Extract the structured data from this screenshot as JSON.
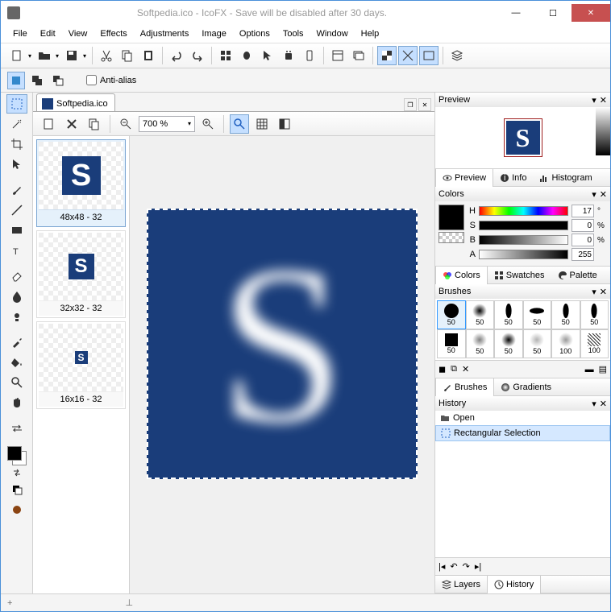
{
  "title": "Softpedia.ico - IcoFX - Save will be disabled after 30 days.",
  "menu": [
    "File",
    "Edit",
    "View",
    "Effects",
    "Adjustments",
    "Image",
    "Options",
    "Tools",
    "Window",
    "Help"
  ],
  "subtoolbar": {
    "antialias_label": "Anti-alias"
  },
  "document": {
    "tab_label": "Softpedia.ico",
    "zoom": "700 %",
    "icons": [
      {
        "label": "48x48 - 32",
        "size": 48,
        "selected": true
      },
      {
        "label": "32x32 - 32",
        "size": 32,
        "selected": false
      },
      {
        "label": "16x16 - 32",
        "size": 16,
        "selected": false
      }
    ]
  },
  "panels": {
    "preview": {
      "title": "Preview",
      "tabs": [
        "Preview",
        "Info",
        "Histogram"
      ]
    },
    "colors": {
      "title": "Colors",
      "h": "17",
      "s": "0",
      "b": "0",
      "a": "255",
      "tabs": [
        "Colors",
        "Swatches",
        "Palette"
      ]
    },
    "brushes": {
      "title": "Brushes",
      "sizes_row1": [
        "50",
        "50",
        "50",
        "50",
        "50",
        "50"
      ],
      "sizes_row2": [
        "50",
        "50",
        "50",
        "50",
        "100",
        "100"
      ],
      "tabs": [
        "Brushes",
        "Gradients"
      ]
    },
    "history": {
      "title": "History",
      "items": [
        "Open",
        "Rectangular Selection"
      ],
      "tabs": [
        "Layers",
        "History"
      ]
    }
  }
}
